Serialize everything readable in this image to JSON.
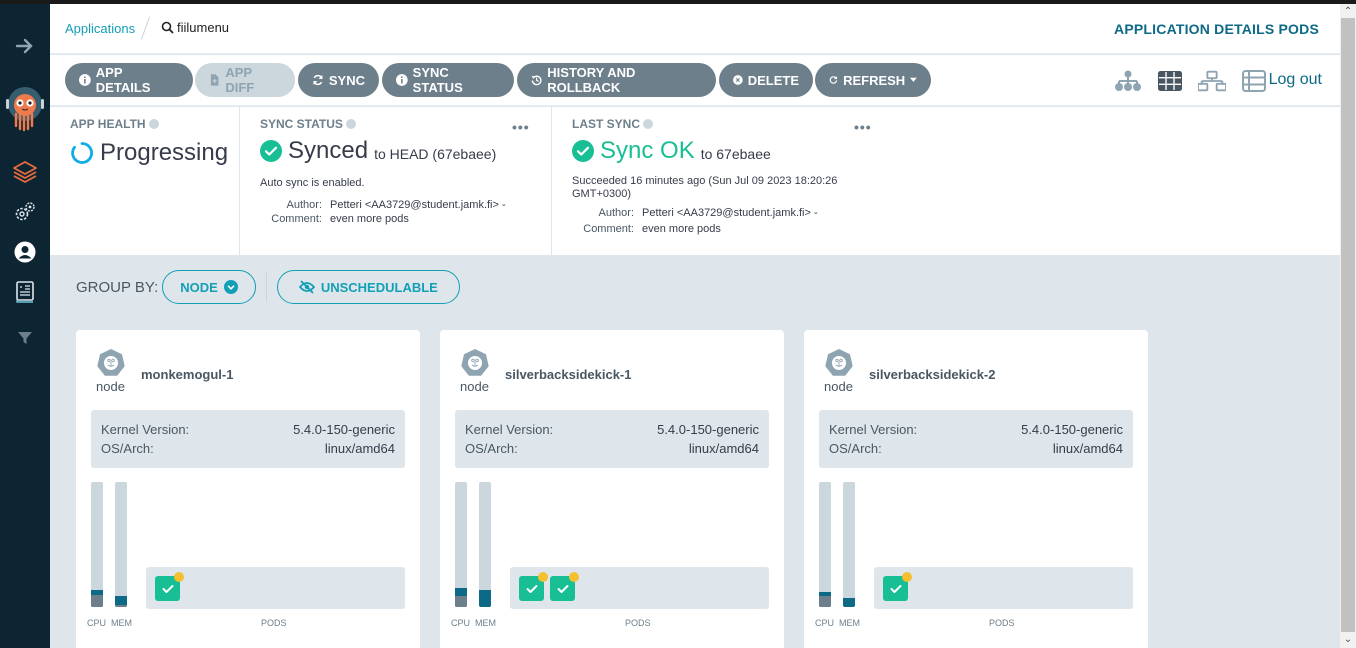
{
  "breadcrumb": {
    "root": "Applications",
    "current": "fiilumenu"
  },
  "page_title": "APPLICATION DETAILS PODS",
  "toolbar": {
    "buttons": [
      {
        "label": "APP DETAILS",
        "icon": "info-circle-icon",
        "disabled": false
      },
      {
        "label": "APP DIFF",
        "icon": "file-diff-icon",
        "disabled": true
      },
      {
        "label": "SYNC",
        "icon": "sync-icon",
        "disabled": false
      },
      {
        "label": "SYNC STATUS",
        "icon": "info-circle-icon",
        "disabled": false
      },
      {
        "label": "HISTORY AND ROLLBACK",
        "icon": "history-icon",
        "disabled": false
      },
      {
        "label": "DELETE",
        "icon": "times-circle-icon",
        "disabled": false
      },
      {
        "label": "REFRESH",
        "icon": "redo-icon",
        "disabled": false
      }
    ],
    "view_icons": [
      "tree-view-icon",
      "pods-view-icon",
      "network-view-icon",
      "list-view-icon"
    ],
    "logout": "Log out"
  },
  "summary": {
    "app_health": {
      "label": "APP HEALTH",
      "status": "Progressing"
    },
    "sync_status": {
      "label": "SYNC STATUS",
      "status": "Synced",
      "ref": "to HEAD (67ebaee)",
      "auto_sync": "Auto sync is enabled.",
      "author_key": "Author:",
      "author": "Petteri <AA3729@student.jamk.fi> -",
      "comment_key": "Comment:",
      "comment": "even more pods",
      "more": "•••"
    },
    "last_sync": {
      "label": "LAST SYNC",
      "status": "Sync OK",
      "ref": "to 67ebaee",
      "time": "Succeeded 16 minutes ago (Sun Jul 09 2023 18:20:26 GMT+0300)",
      "author_key": "Author:",
      "author": "Petteri <AA3729@student.jamk.fi> -",
      "comment_key": "Comment:",
      "comment": "even more pods",
      "more": "•••"
    }
  },
  "group_by": {
    "label": "GROUP BY:",
    "value": "NODE",
    "unschedulable": "UNSCHEDULABLE"
  },
  "colors": {
    "accent": "#139fb6",
    "brand": "#0d6a86",
    "success": "#18be94",
    "button": "#6d7f8b",
    "warning_dot": "#f4c030"
  },
  "nodes": [
    {
      "kind": "node",
      "name": "monkemogul-1",
      "kernel_key": "Kernel Version:",
      "kernel": "5.4.0-150-generic",
      "os_key": "OS/Arch:",
      "os": "linux/amd64",
      "cpu": {
        "used_pct": 10,
        "requested_pct": 14
      },
      "mem": {
        "used_pct": 2,
        "requested_pct": 9
      },
      "pods": 1,
      "cpu_label": "CPU",
      "mem_label": "MEM",
      "pods_label": "PODS"
    },
    {
      "kind": "node",
      "name": "silverbacksidekick-1",
      "kernel_key": "Kernel Version:",
      "kernel": "5.4.0-150-generic",
      "os_key": "OS/Arch:",
      "os": "linux/amd64",
      "cpu": {
        "used_pct": 9,
        "requested_pct": 15
      },
      "mem": {
        "used_pct": 0,
        "requested_pct": 14
      },
      "pods": 2,
      "cpu_label": "CPU",
      "mem_label": "MEM",
      "pods_label": "PODS"
    },
    {
      "kind": "node",
      "name": "silverbacksidekick-2",
      "kernel_key": "Kernel Version:",
      "kernel": "5.4.0-150-generic",
      "os_key": "OS/Arch:",
      "os": "linux/amd64",
      "cpu": {
        "used_pct": 9,
        "requested_pct": 12
      },
      "mem": {
        "used_pct": 0,
        "requested_pct": 7
      },
      "pods": 1,
      "cpu_label": "CPU",
      "mem_label": "MEM",
      "pods_label": "PODS"
    }
  ]
}
